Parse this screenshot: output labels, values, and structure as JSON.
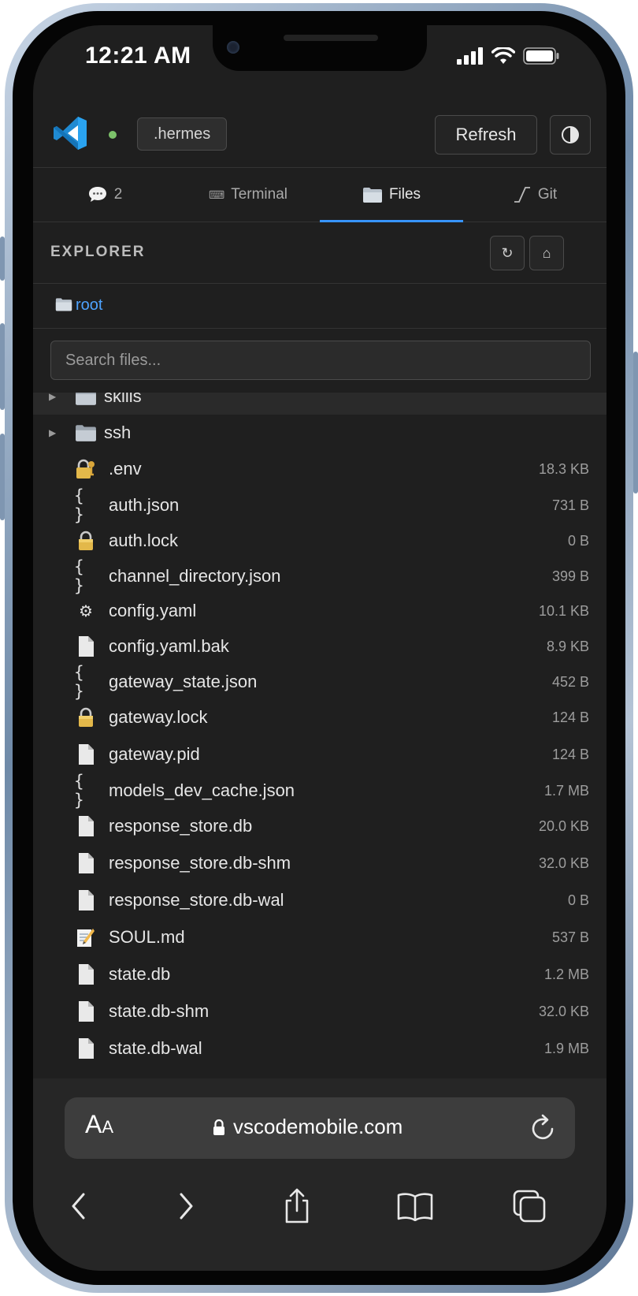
{
  "status_bar": {
    "time": "12:21 AM"
  },
  "header": {
    "workspace": ".hermes",
    "refresh_label": "Refresh"
  },
  "tabs": [
    {
      "label": "2",
      "icon": "chat-bubble-icon"
    },
    {
      "label": "Terminal",
      "icon": "keyboard-icon"
    },
    {
      "label": "Files",
      "icon": "folder-icon",
      "active": true
    },
    {
      "label": "Git",
      "icon": "git-icon"
    }
  ],
  "explorer": {
    "title": "EXPLORER",
    "refresh_icon": "↻",
    "home_icon": "⌂",
    "breadcrumb": "root",
    "search_placeholder": "Search files..."
  },
  "files": [
    {
      "name": "skills",
      "type": "folder",
      "size": ""
    },
    {
      "name": "ssh",
      "type": "folder",
      "size": ""
    },
    {
      "name": ".env",
      "type": "lock-key",
      "size": "18.3 KB"
    },
    {
      "name": "auth.json",
      "type": "json",
      "size": "731 B"
    },
    {
      "name": "auth.lock",
      "type": "lock",
      "size": "0 B"
    },
    {
      "name": "channel_directory.json",
      "type": "json",
      "size": "399 B"
    },
    {
      "name": "config.yaml",
      "type": "gear",
      "size": "10.1 KB"
    },
    {
      "name": "config.yaml.bak",
      "type": "file",
      "size": "8.9 KB"
    },
    {
      "name": "gateway_state.json",
      "type": "json",
      "size": "452 B"
    },
    {
      "name": "gateway.lock",
      "type": "lock",
      "size": "124 B"
    },
    {
      "name": "gateway.pid",
      "type": "file",
      "size": "124 B"
    },
    {
      "name": "models_dev_cache.json",
      "type": "json",
      "size": "1.7 MB"
    },
    {
      "name": "response_store.db",
      "type": "file",
      "size": "20.0 KB"
    },
    {
      "name": "response_store.db-shm",
      "type": "file",
      "size": "32.0 KB"
    },
    {
      "name": "response_store.db-wal",
      "type": "file",
      "size": "0 B"
    },
    {
      "name": "SOUL.md",
      "type": "memo",
      "size": "537 B"
    },
    {
      "name": "state.db",
      "type": "file",
      "size": "1.2 MB"
    },
    {
      "name": "state.db-shm",
      "type": "file",
      "size": "32.0 KB"
    },
    {
      "name": "state.db-wal",
      "type": "file",
      "size": "1.9 MB"
    }
  ],
  "browser": {
    "aa_label": "A",
    "aa_small": "A",
    "url": "vscodemobile.com"
  },
  "colors": {
    "accent": "#3794ff",
    "background": "#1f1f1f",
    "link": "#4ea3ff"
  }
}
